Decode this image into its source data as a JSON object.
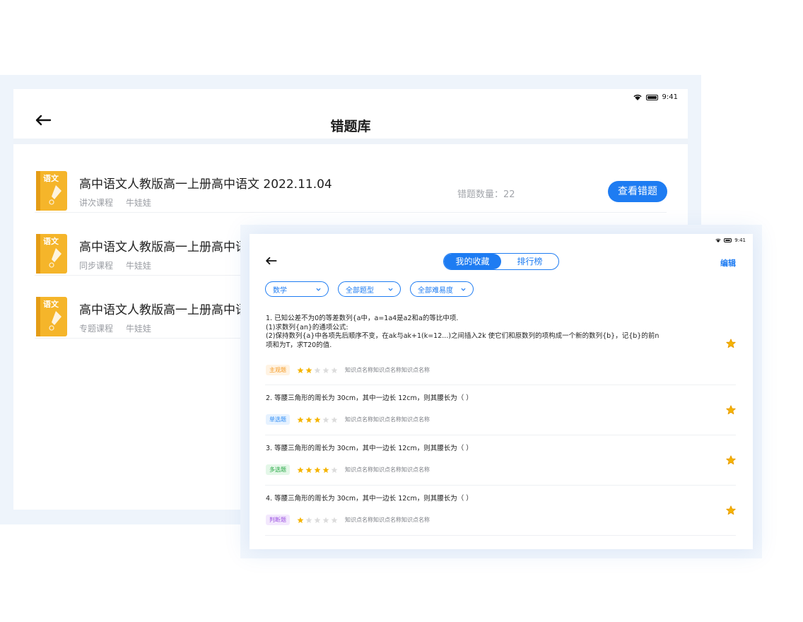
{
  "status": {
    "time": "9:41"
  },
  "back": {
    "title": "错题库",
    "count_label": "错题数量：",
    "courses": [
      {
        "title": "高中语文人教版高一上册高中语文 2022.11.04",
        "type": "讲次课程",
        "teacher": "牛娃娃",
        "count": "22",
        "button": "查看错题",
        "cover_label": "语文"
      },
      {
        "title": "高中语文人教版高一上册高中语",
        "type": "同步课程",
        "teacher": "牛娃娃",
        "cover_label": "语文"
      },
      {
        "title": "高中语文人教版高一上册高中语",
        "type": "专题课程",
        "teacher": "牛娃娃",
        "cover_label": "语文"
      }
    ]
  },
  "front": {
    "tabs": [
      {
        "label": "我的收藏",
        "active": true
      },
      {
        "label": "排行榜",
        "active": false
      }
    ],
    "edit": "编辑",
    "filters": [
      "数学",
      "全部题型",
      "全部难易度"
    ],
    "questions": [
      {
        "lines": [
          "1. 已知公差不为0的等差数列{a中，a=1a4是a2和a的等比中项.",
          "(1)求数列{an}的通项公式:",
          "(2)保持数列{a}中各项先后顺序不变，在ak与ak+1(k=12...)之间插入2k 使它们和原数列的项构成一个新的数列{b}，记{b}的前n",
          "项和为T，求T20的值."
        ],
        "tag": "主观题",
        "tag_color": "#f59a23",
        "tag_bg": "#fff3e3",
        "difficulty": 2,
        "knowledge": "知识点名称知识点名称知识点名称"
      },
      {
        "lines": [
          "2. 等腰三角形的周长为 30cm，其中一边长 12cm，则其腰长为（    ）"
        ],
        "tag": "单选题",
        "tag_color": "#2f8df5",
        "tag_bg": "#e6f2ff",
        "difficulty": 3,
        "knowledge": "知识点名称知识点名称知识点名称"
      },
      {
        "lines": [
          "3. 等腰三角形的周长为 30cm，其中一边长 12cm，则其腰长为（    ）"
        ],
        "tag": "多选题",
        "tag_color": "#27a845",
        "tag_bg": "#e4f7e8",
        "difficulty": 4,
        "knowledge": "知识点名称知识点名称知识点名称"
      },
      {
        "lines": [
          "4. 等腰三角形的周长为 30cm，其中一边长 12cm，则其腰长为（    ）"
        ],
        "tag": "判断题",
        "tag_color": "#9b51e0",
        "tag_bg": "#f3e8fd",
        "difficulty": 1,
        "knowledge": "知识点名称知识点名称知识点名称"
      }
    ]
  },
  "colors": {
    "accent": "#1e7cf2",
    "star_on": "#f5b400",
    "star_off": "#dcdcdc",
    "book": "#f5b52a"
  }
}
